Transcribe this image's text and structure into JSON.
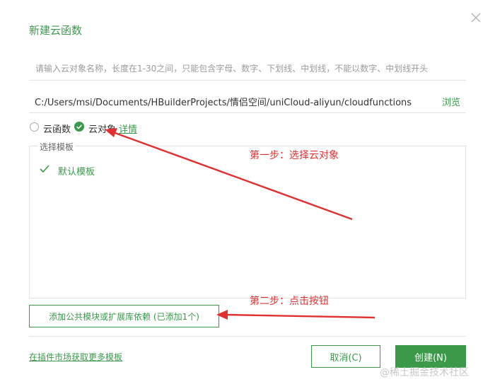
{
  "dialog": {
    "title": "新建云函数",
    "close_icon": "close-icon"
  },
  "name_field": {
    "value": "",
    "placeholder": "请输入云对象名称，长度在1-30之间，只能包含字母、数字、下划线、中划线，不能以数字、中划线开头"
  },
  "path_field": {
    "value": "C:/Users/msi/Documents/HBuilderProjects/情侣空间/uniCloud-aliyun/cloudfunctions",
    "browse_label": "浏览"
  },
  "type_options": [
    {
      "label": "云函数",
      "selected": false
    },
    {
      "label": "云对象",
      "selected": true
    }
  ],
  "detail_link": "详情",
  "template_section": {
    "legend": "选择模板",
    "items": [
      {
        "label": "默认模板",
        "selected": true,
        "icon": "check-icon"
      }
    ]
  },
  "module_button": "添加公共模块或扩展库依赖 (已添加1个)",
  "market_link": "在插件市场获取更多模板",
  "actions": {
    "cancel_label": "取消(C)",
    "create_label": "创建(N)"
  },
  "annotations": {
    "step1": "第一步：选择云对象",
    "step2": "第二步：点击按钮"
  },
  "watermark": "@稀土掘金技术社区",
  "colors": {
    "accent": "#3a9a4a",
    "annotation": "#e03131",
    "border": "#e3e3e3"
  }
}
